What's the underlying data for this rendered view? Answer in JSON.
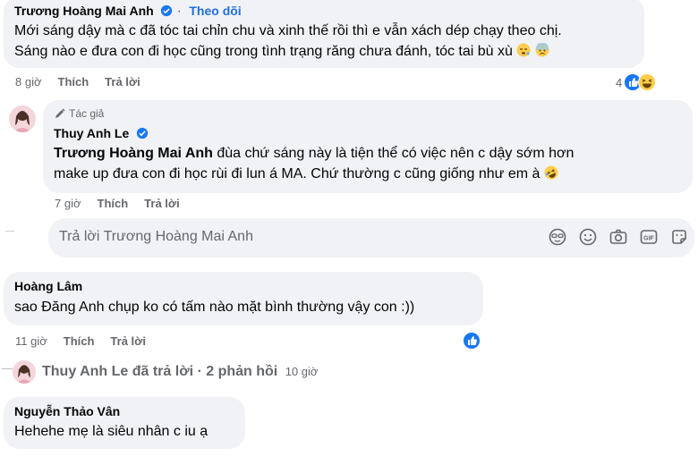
{
  "comments": [
    {
      "author": "Trương Hoàng Mai Anh",
      "follow_label": "Theo dõi",
      "lines": [
        "Mới sáng dậy mà c đã tóc tai chỉn chu và xinh thế rồi thì e vẫn xách dép chạy theo chị.",
        "Sáng nào e đưa con đi học cũng trong tình trạng răng chưa đánh, tóc tai bù xù"
      ],
      "time": "8 giờ",
      "like": "Thích",
      "reply": "Trả lời",
      "reaction_count": "4"
    },
    {
      "badge": "Tác giả",
      "author": "Thuy Anh Le",
      "mention": "Trương Hoàng Mai Anh",
      "lines": [
        " đùa chứ sáng này là tiện thể có việc nên c dậy sớm hơn",
        "make up đưa con đi học rùi đi lun á MA. Chứ thường c cũng giống như em à"
      ],
      "time": "7 giờ",
      "like": "Thích",
      "reply": "Trả lời"
    },
    {
      "author": "Hoàng Lâm",
      "lines": [
        "sao Đăng Anh chụp ko có tấm nào mặt bình thường vậy con :))"
      ],
      "time": "11 giờ",
      "like": "Thích",
      "reply": "Trả lời"
    },
    {
      "author": "Nguyễn Thảo Vân",
      "lines": [
        "Hehehe mẹ là siêu nhân c iu ạ"
      ]
    }
  ],
  "reply_box": {
    "placeholder": "Trả lời Trương Hoàng Mai Anh"
  },
  "replies_summary": {
    "text": "Thuy Anh Le đã trả lời · 2 phản hồi",
    "time": "10 giờ"
  },
  "colors": {
    "bubble": "#f0f2f5",
    "link": "#216fdb",
    "like_blue": "#1877f2",
    "muted": "#65676b"
  }
}
